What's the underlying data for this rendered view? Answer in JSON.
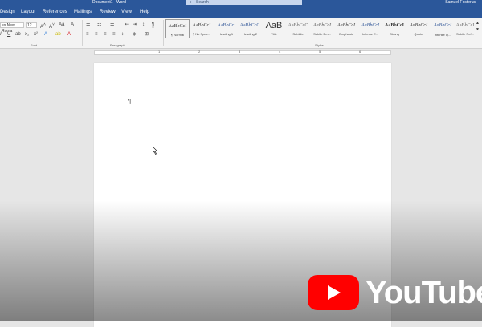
{
  "titlebar": {
    "doc_title": "Document1 - Word",
    "search_placeholder": "Search",
    "user": "Samuel Fosterus"
  },
  "tabs": [
    "Design",
    "Layout",
    "References",
    "Mailings",
    "Review",
    "View",
    "Help"
  ],
  "font": {
    "name": "es New Roma",
    "size": "12"
  },
  "ribbon_groups": {
    "font": "Font",
    "paragraph": "Paragraph",
    "styles": "Styles"
  },
  "styles": [
    {
      "preview": "AaBbCcI",
      "name": "¶ Normal"
    },
    {
      "preview": "AaBbCcI",
      "name": "¶ No Spac..."
    },
    {
      "preview": "AaBbCc",
      "name": "Heading 1"
    },
    {
      "preview": "AaBbCcC",
      "name": "Heading 2"
    },
    {
      "preview": "AaB",
      "name": "Title"
    },
    {
      "preview": "AaBbCcC",
      "name": "Subtitle"
    },
    {
      "preview": "AaBbCcI",
      "name": "Subtle Em..."
    },
    {
      "preview": "AaBbCcI",
      "name": "Emphasis"
    },
    {
      "preview": "AaBbCcI",
      "name": "Intense E..."
    },
    {
      "preview": "AaBbCcI",
      "name": "Strong"
    },
    {
      "preview": "AaBbCcI",
      "name": "Quote"
    },
    {
      "preview": "AaBbCcI",
      "name": "Intense Q..."
    },
    {
      "preview": "AaBbCcI",
      "name": "Subtle Ref..."
    }
  ],
  "ruler_numbers": [
    "1",
    "2",
    "3",
    "4",
    "5",
    "6"
  ],
  "document": {
    "pilcrow": "¶"
  },
  "watermark": {
    "text": "YouTube"
  }
}
